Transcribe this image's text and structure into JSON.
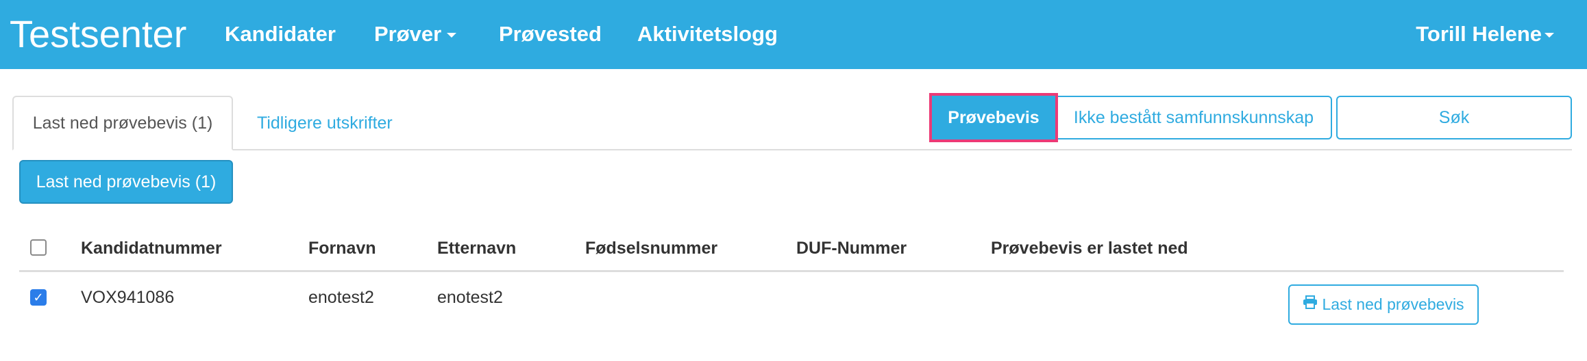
{
  "navbar": {
    "brand": "Testsenter",
    "items": [
      {
        "label": "Kandidater",
        "has_dropdown": false
      },
      {
        "label": "Prøver",
        "has_dropdown": true
      },
      {
        "label": "Prøvested",
        "has_dropdown": false
      },
      {
        "label": "Aktivitetslogg",
        "has_dropdown": false
      }
    ],
    "user": "Torill Helene",
    "color": "#2fabe0"
  },
  "tabs": [
    {
      "label": "Last ned prøvebevis (1)",
      "active": true
    },
    {
      "label": "Tidligere utskrifter",
      "active": false
    }
  ],
  "filter_buttons": [
    {
      "label": "Prøvebevis",
      "active": true
    },
    {
      "label": "Ikke bestått samfunnskunnskap",
      "active": false
    },
    {
      "label": "Søk",
      "active": false
    }
  ],
  "download_button": "Last ned prøvebevis (1)",
  "table": {
    "select_all_checked": false,
    "columns": [
      "Kandidatnummer",
      "Fornavn",
      "Etternavn",
      "Fødselsnummer",
      "DUF-Nummer",
      "Prøvebevis er lastet ned"
    ],
    "rows": [
      {
        "checked": true,
        "kandidatnummer": "VOX941086",
        "fornavn": "enotest2",
        "etternavn": "enotest2",
        "fodselsnummer": "",
        "duf_nummer": "",
        "lastet_ned": "",
        "action_label": "Last ned prøvebevis",
        "action_icon": "printer-icon"
      }
    ]
  },
  "colors": {
    "accent": "#2fabe0",
    "highlight": "#ec3a76",
    "checkbox": "#2b7de9"
  }
}
